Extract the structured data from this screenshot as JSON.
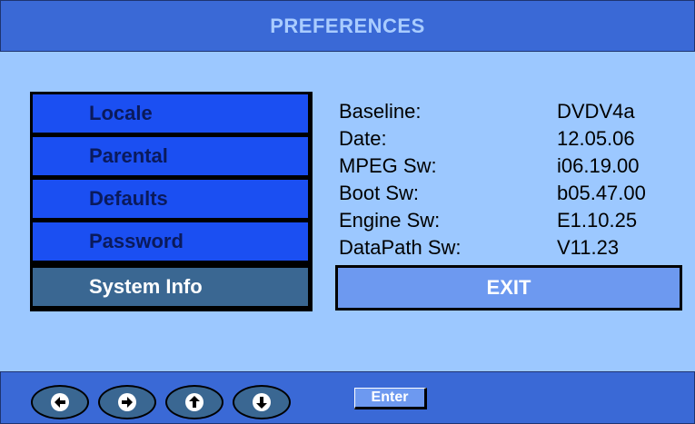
{
  "title": "PREFERENCES",
  "menu": {
    "items": [
      {
        "label": "Locale",
        "selected": false
      },
      {
        "label": "Parental",
        "selected": false
      },
      {
        "label": "Defaults",
        "selected": false
      },
      {
        "label": "Password",
        "selected": false
      },
      {
        "label": "System Info",
        "selected": true
      }
    ]
  },
  "info": [
    {
      "key": "Baseline:",
      "value": "DVDV4a"
    },
    {
      "key": "Date:",
      "value": "12.05.06"
    },
    {
      "key": "MPEG Sw:",
      "value": "i06.19.00"
    },
    {
      "key": "Boot Sw:",
      "value": "b05.47.00"
    },
    {
      "key": "Engine Sw:",
      "value": "E1.10.25"
    },
    {
      "key": "DataPath Sw:",
      "value": "V11.23"
    }
  ],
  "exit_label": "EXIT",
  "nav": {
    "icons": [
      "left-arrow-icon",
      "right-arrow-icon",
      "up-arrow-icon",
      "down-arrow-icon"
    ],
    "enter_label": "Enter"
  },
  "colors": {
    "background": "#9cc8ff",
    "bar": "#3a69d6",
    "menu_item": "#1b4ff2",
    "menu_selected": "#3a6792",
    "exit": "#6d99f0"
  }
}
